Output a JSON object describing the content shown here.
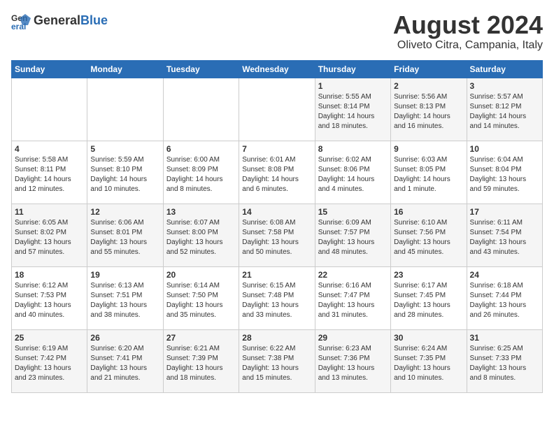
{
  "header": {
    "logo_general": "General",
    "logo_blue": "Blue",
    "title": "August 2024",
    "subtitle": "Oliveto Citra, Campania, Italy"
  },
  "weekdays": [
    "Sunday",
    "Monday",
    "Tuesday",
    "Wednesday",
    "Thursday",
    "Friday",
    "Saturday"
  ],
  "weeks": [
    [
      {
        "day": "",
        "info": ""
      },
      {
        "day": "",
        "info": ""
      },
      {
        "day": "",
        "info": ""
      },
      {
        "day": "",
        "info": ""
      },
      {
        "day": "1",
        "info": "Sunrise: 5:55 AM\nSunset: 8:14 PM\nDaylight: 14 hours\nand 18 minutes."
      },
      {
        "day": "2",
        "info": "Sunrise: 5:56 AM\nSunset: 8:13 PM\nDaylight: 14 hours\nand 16 minutes."
      },
      {
        "day": "3",
        "info": "Sunrise: 5:57 AM\nSunset: 8:12 PM\nDaylight: 14 hours\nand 14 minutes."
      }
    ],
    [
      {
        "day": "4",
        "info": "Sunrise: 5:58 AM\nSunset: 8:11 PM\nDaylight: 14 hours\nand 12 minutes."
      },
      {
        "day": "5",
        "info": "Sunrise: 5:59 AM\nSunset: 8:10 PM\nDaylight: 14 hours\nand 10 minutes."
      },
      {
        "day": "6",
        "info": "Sunrise: 6:00 AM\nSunset: 8:09 PM\nDaylight: 14 hours\nand 8 minutes."
      },
      {
        "day": "7",
        "info": "Sunrise: 6:01 AM\nSunset: 8:08 PM\nDaylight: 14 hours\nand 6 minutes."
      },
      {
        "day": "8",
        "info": "Sunrise: 6:02 AM\nSunset: 8:06 PM\nDaylight: 14 hours\nand 4 minutes."
      },
      {
        "day": "9",
        "info": "Sunrise: 6:03 AM\nSunset: 8:05 PM\nDaylight: 14 hours\nand 1 minute."
      },
      {
        "day": "10",
        "info": "Sunrise: 6:04 AM\nSunset: 8:04 PM\nDaylight: 13 hours\nand 59 minutes."
      }
    ],
    [
      {
        "day": "11",
        "info": "Sunrise: 6:05 AM\nSunset: 8:02 PM\nDaylight: 13 hours\nand 57 minutes."
      },
      {
        "day": "12",
        "info": "Sunrise: 6:06 AM\nSunset: 8:01 PM\nDaylight: 13 hours\nand 55 minutes."
      },
      {
        "day": "13",
        "info": "Sunrise: 6:07 AM\nSunset: 8:00 PM\nDaylight: 13 hours\nand 52 minutes."
      },
      {
        "day": "14",
        "info": "Sunrise: 6:08 AM\nSunset: 7:58 PM\nDaylight: 13 hours\nand 50 minutes."
      },
      {
        "day": "15",
        "info": "Sunrise: 6:09 AM\nSunset: 7:57 PM\nDaylight: 13 hours\nand 48 minutes."
      },
      {
        "day": "16",
        "info": "Sunrise: 6:10 AM\nSunset: 7:56 PM\nDaylight: 13 hours\nand 45 minutes."
      },
      {
        "day": "17",
        "info": "Sunrise: 6:11 AM\nSunset: 7:54 PM\nDaylight: 13 hours\nand 43 minutes."
      }
    ],
    [
      {
        "day": "18",
        "info": "Sunrise: 6:12 AM\nSunset: 7:53 PM\nDaylight: 13 hours\nand 40 minutes."
      },
      {
        "day": "19",
        "info": "Sunrise: 6:13 AM\nSunset: 7:51 PM\nDaylight: 13 hours\nand 38 minutes."
      },
      {
        "day": "20",
        "info": "Sunrise: 6:14 AM\nSunset: 7:50 PM\nDaylight: 13 hours\nand 35 minutes."
      },
      {
        "day": "21",
        "info": "Sunrise: 6:15 AM\nSunset: 7:48 PM\nDaylight: 13 hours\nand 33 minutes."
      },
      {
        "day": "22",
        "info": "Sunrise: 6:16 AM\nSunset: 7:47 PM\nDaylight: 13 hours\nand 31 minutes."
      },
      {
        "day": "23",
        "info": "Sunrise: 6:17 AM\nSunset: 7:45 PM\nDaylight: 13 hours\nand 28 minutes."
      },
      {
        "day": "24",
        "info": "Sunrise: 6:18 AM\nSunset: 7:44 PM\nDaylight: 13 hours\nand 26 minutes."
      }
    ],
    [
      {
        "day": "25",
        "info": "Sunrise: 6:19 AM\nSunset: 7:42 PM\nDaylight: 13 hours\nand 23 minutes."
      },
      {
        "day": "26",
        "info": "Sunrise: 6:20 AM\nSunset: 7:41 PM\nDaylight: 13 hours\nand 21 minutes."
      },
      {
        "day": "27",
        "info": "Sunrise: 6:21 AM\nSunset: 7:39 PM\nDaylight: 13 hours\nand 18 minutes."
      },
      {
        "day": "28",
        "info": "Sunrise: 6:22 AM\nSunset: 7:38 PM\nDaylight: 13 hours\nand 15 minutes."
      },
      {
        "day": "29",
        "info": "Sunrise: 6:23 AM\nSunset: 7:36 PM\nDaylight: 13 hours\nand 13 minutes."
      },
      {
        "day": "30",
        "info": "Sunrise: 6:24 AM\nSunset: 7:35 PM\nDaylight: 13 hours\nand 10 minutes."
      },
      {
        "day": "31",
        "info": "Sunrise: 6:25 AM\nSunset: 7:33 PM\nDaylight: 13 hours\nand 8 minutes."
      }
    ]
  ]
}
